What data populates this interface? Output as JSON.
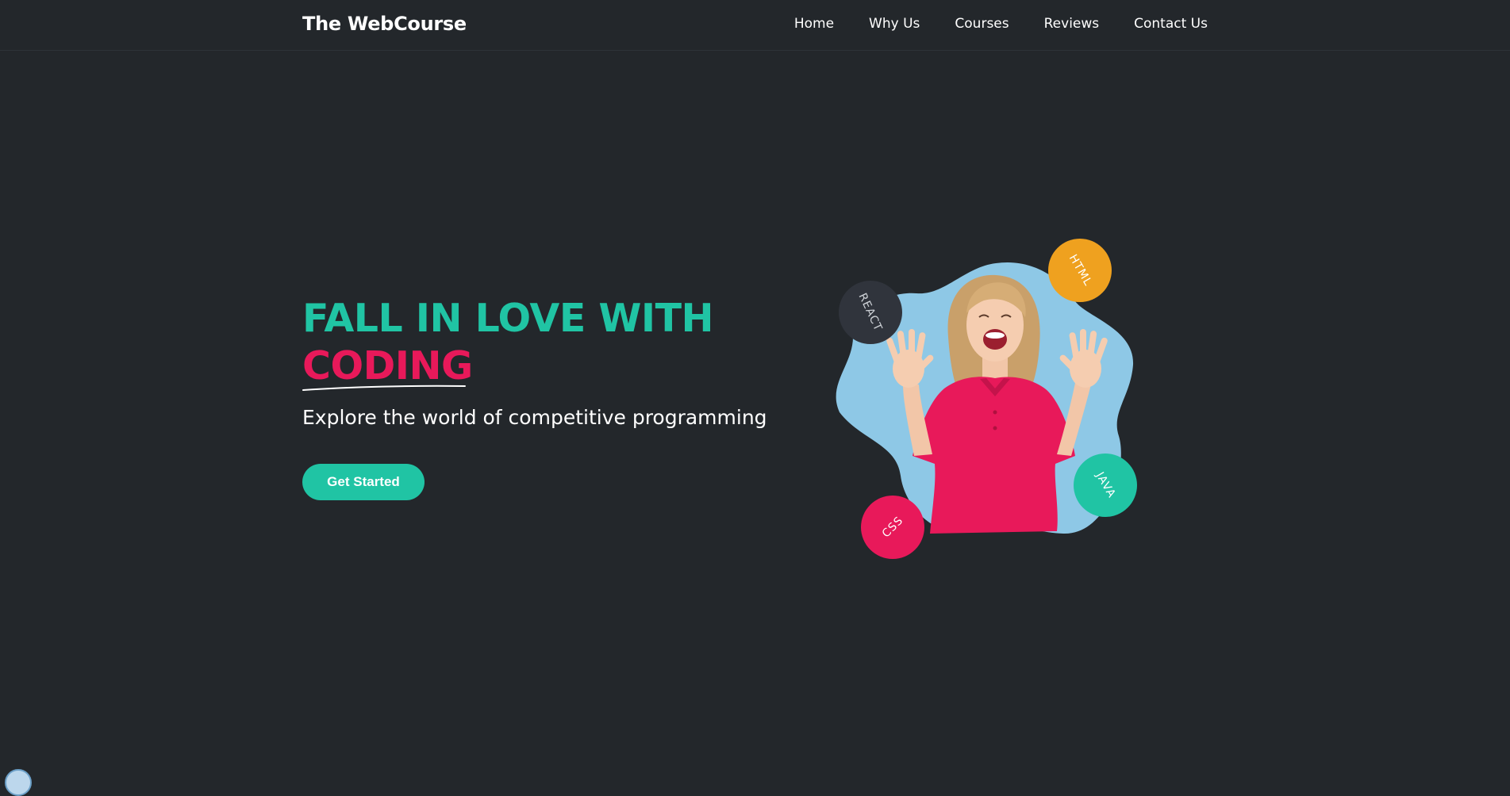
{
  "brand": "The WebCourse",
  "nav": [
    {
      "label": "Home"
    },
    {
      "label": "Why Us"
    },
    {
      "label": "Courses"
    },
    {
      "label": "Reviews"
    },
    {
      "label": "Contact Us"
    }
  ],
  "hero": {
    "headline_line1": "FALL IN LOVE WITH",
    "headline_line2": "CODING",
    "subtitle": "Explore the world of competitive programming",
    "cta_label": "Get Started"
  },
  "badges": {
    "react": "REACT",
    "html": "HTML",
    "java": "JAVA",
    "css": "CSS"
  },
  "colors": {
    "background": "#23272b",
    "accent_teal": "#20c4a4",
    "accent_pink": "#e8195a",
    "accent_orange": "#efa11f",
    "badge_dark": "#30343c",
    "blob_blue": "#8ec8e6"
  }
}
